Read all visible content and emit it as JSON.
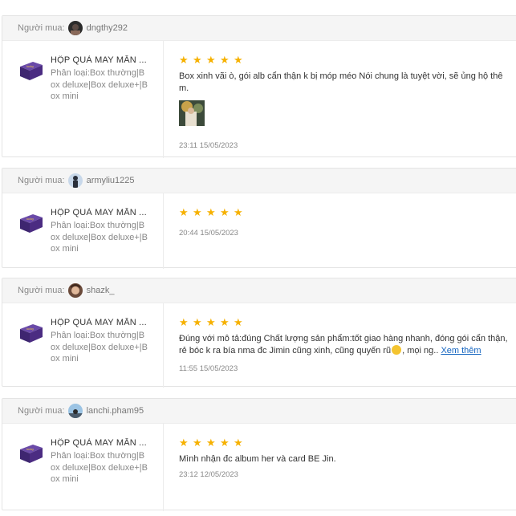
{
  "buyer_label": "Người mua:",
  "reviews": [
    {
      "username": "dngthy292",
      "product_name": "HỘP QUÀ MAY MẮN ...",
      "variant": "Phân loại:Box thường|Box deluxe|Box deluxe+|Box mini",
      "rating": 5,
      "text": "Box xinh vãi ò, gói alb cẩn thận k bị móp méo Nói chung là tuyệt vời, sẽ ủng hộ thêm.",
      "time": "23:11 15/05/2023"
    },
    {
      "username": "armyliu1225",
      "product_name": "HỘP QUÀ MAY MẮN ...",
      "variant": "Phân loại:Box thường|Box deluxe|Box deluxe+|Box mini",
      "rating": 5,
      "text": "",
      "time": "20:44 15/05/2023"
    },
    {
      "username": "shazk_",
      "product_name": "HỘP QUÀ MAY MẮN ...",
      "variant": "Phân loại:Box thường|Box deluxe|Box deluxe+|Box mini",
      "rating": 5,
      "text": "Đúng với mô tả:đúng Chất lượng sản phẩm:tốt giao hàng nhanh, đóng gói cẩn thận, rẻ bóc k ra bía nma đc Jimin cũng xinh, cũng quyến rũ",
      "text_after_emoji": ", mọi ng..",
      "see_more": "Xem thêm",
      "time": "11:55 15/05/2023"
    },
    {
      "username": "lanchi.pham95",
      "product_name": "HỘP QUÀ MAY MẮN ...",
      "variant": "Phân loại:Box thường|Box deluxe|Box deluxe+|Box mini",
      "rating": 5,
      "text": "Mình nhận đc album her và card BE Jin.",
      "time": "23:12 12/05/2023"
    }
  ],
  "colors": {
    "star": "#f6b100",
    "link": "#1565c0",
    "box": "#4b2c82"
  }
}
